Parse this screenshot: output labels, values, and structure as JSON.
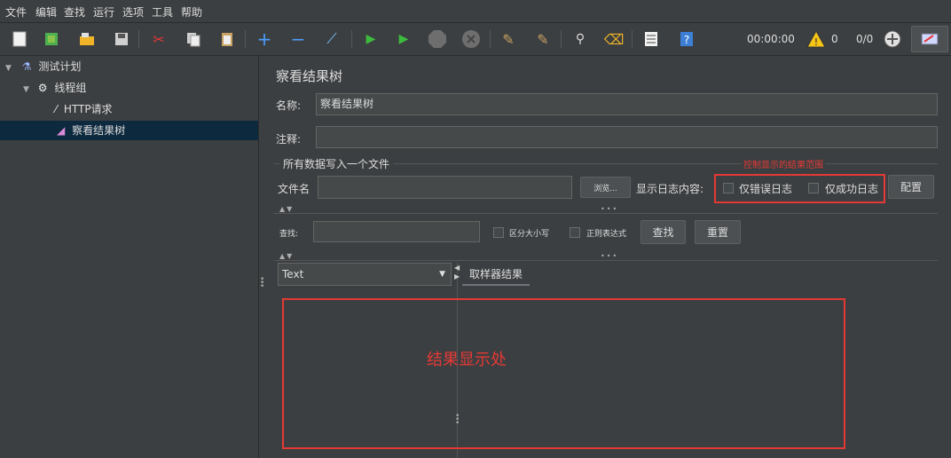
{
  "menu": [
    "文件",
    "编辑",
    "查找",
    "运行",
    "选项",
    "工具",
    "帮助"
  ],
  "toolbar": {
    "timer": "00:00:00",
    "warning_count": "0",
    "thread_ratio": "0/0"
  },
  "tree": {
    "items": [
      {
        "label": "测试计划"
      },
      {
        "label": "线程组"
      },
      {
        "label": "HTTP请求"
      },
      {
        "label": "察看结果树"
      }
    ]
  },
  "panel": {
    "title": "察看结果树",
    "name_label": "名称:",
    "name_value": "察看结果树",
    "comment_label": "注释:",
    "comment_value": "",
    "file_section": "所有数据写入一个文件",
    "filename_label": "文件名",
    "filename_value": "",
    "browse_button": "浏览...",
    "log_content_label": "显示日志内容:",
    "errors_only": "仅错误日志",
    "success_only": "仅成功日志",
    "configure_button": "配置",
    "annotation_range": "控制显示的结果范围",
    "search_label": "查找:",
    "search_value": "",
    "case_sensitive": "区分大小写",
    "regex": "正则表达式",
    "find_button": "查找",
    "reset_button": "重置",
    "renderer_select": "Text",
    "result_tab": "取样器结果",
    "annotation_result": "结果显示处"
  },
  "colors": {
    "annotation_red": "#e53935",
    "selection": "#0d293e",
    "warning": "#f5c518",
    "run_green": "#3dbb3d"
  }
}
